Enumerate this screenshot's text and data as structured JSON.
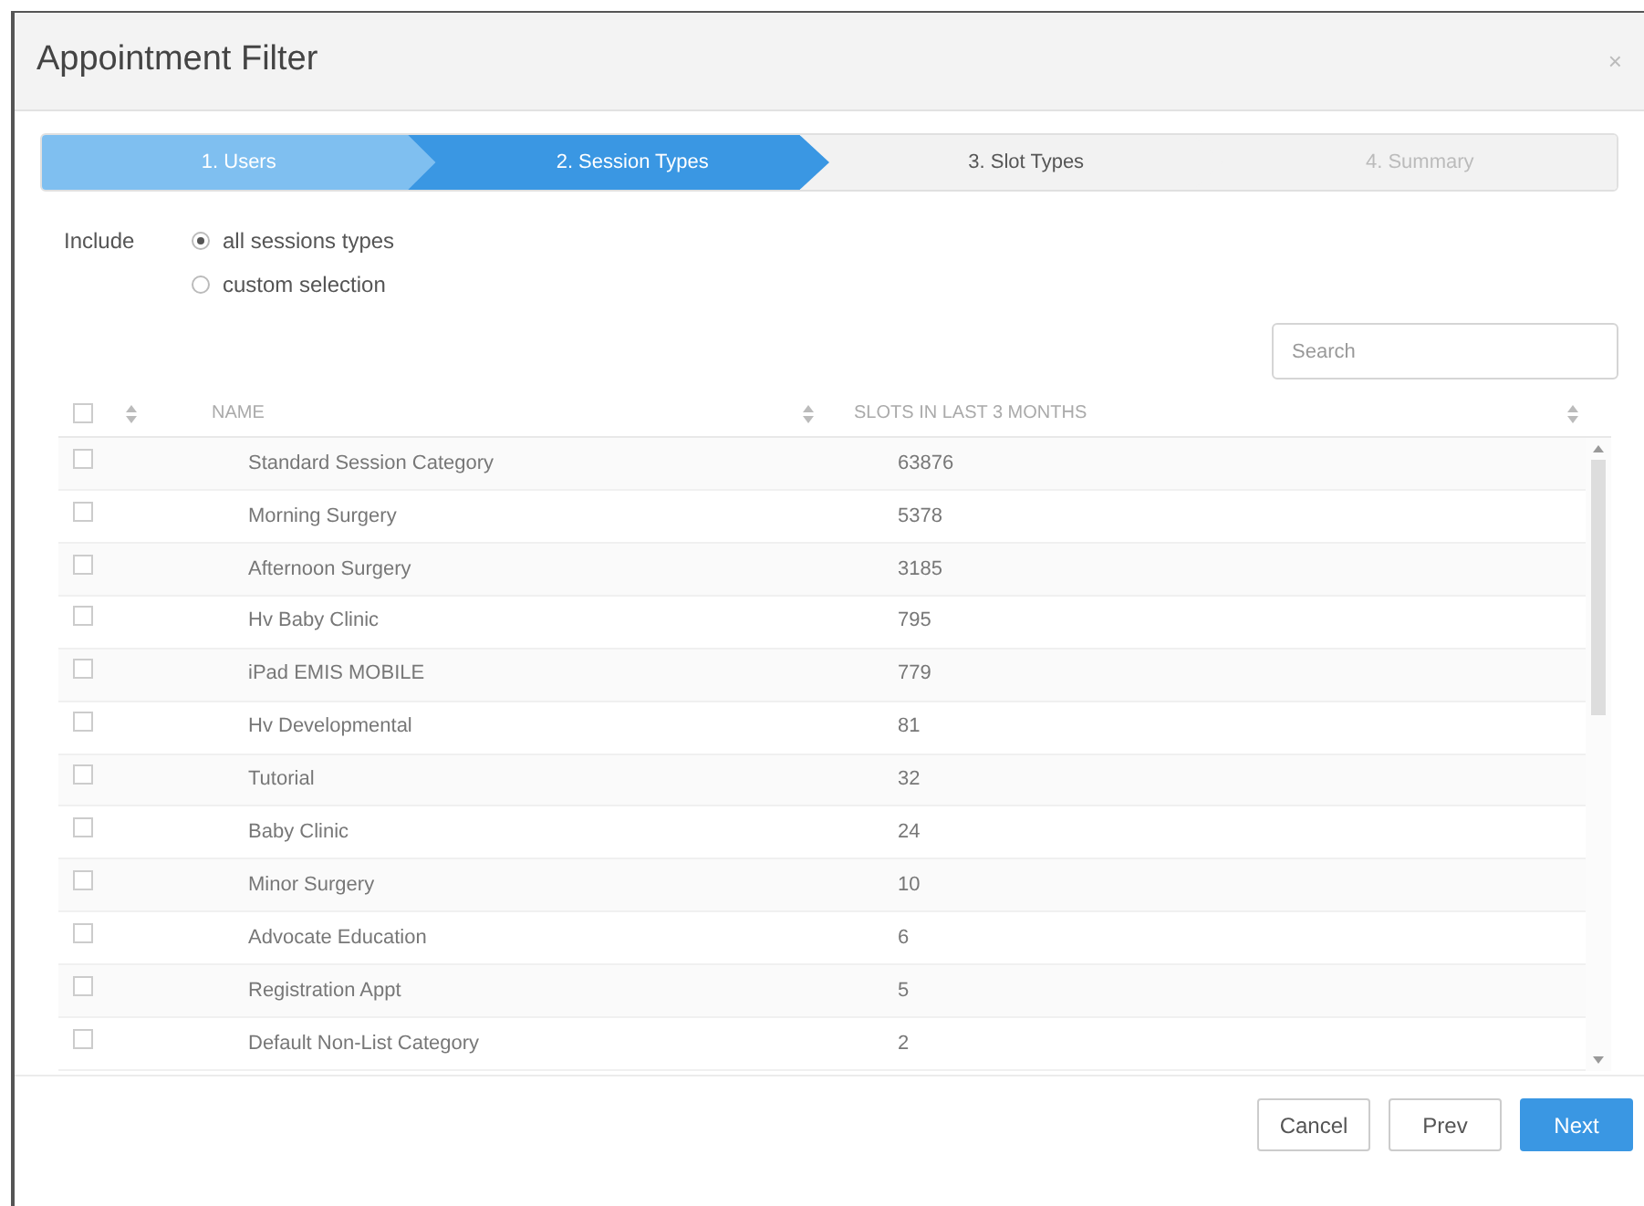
{
  "dialog": {
    "title": "Appointment Filter",
    "close": "×"
  },
  "steps": [
    {
      "label": "1. Users",
      "kind": "done"
    },
    {
      "label": "2. Session Types",
      "kind": "active"
    },
    {
      "label": "3. Slot Types",
      "kind": "upcoming"
    },
    {
      "label": "4. Summary",
      "kind": "disabled"
    }
  ],
  "include": {
    "label": "Include",
    "options": [
      {
        "label": "all sessions types",
        "selected": true
      },
      {
        "label": "custom selection",
        "selected": false
      }
    ]
  },
  "search": {
    "placeholder": "Search"
  },
  "table": {
    "all_checked": false,
    "columns": [
      "NAME",
      "SLOTS IN LAST 3 MONTHS"
    ],
    "rows": [
      {
        "name": "Standard Session Category",
        "slots": "63876",
        "checked": false
      },
      {
        "name": "Morning Surgery",
        "slots": "5378",
        "checked": false
      },
      {
        "name": "Afternoon Surgery",
        "slots": "3185",
        "checked": false
      },
      {
        "name": "Hv Baby Clinic",
        "slots": "795",
        "checked": false
      },
      {
        "name": "iPad EMIS MOBILE",
        "slots": "779",
        "checked": false
      },
      {
        "name": "Hv Developmental",
        "slots": "81",
        "checked": false
      },
      {
        "name": "Tutorial",
        "slots": "32",
        "checked": false
      },
      {
        "name": "Baby Clinic",
        "slots": "24",
        "checked": false
      },
      {
        "name": "Minor Surgery",
        "slots": "10",
        "checked": false
      },
      {
        "name": "Advocate Education",
        "slots": "6",
        "checked": false
      },
      {
        "name": "Registration Appt",
        "slots": "5",
        "checked": false
      },
      {
        "name": "Default Non-List Category",
        "slots": "2",
        "checked": false
      }
    ]
  },
  "buttons": [
    {
      "label": "Cancel",
      "kind": "default"
    },
    {
      "label": "Prev",
      "kind": "default"
    },
    {
      "label": "Next",
      "kind": "primary"
    }
  ]
}
